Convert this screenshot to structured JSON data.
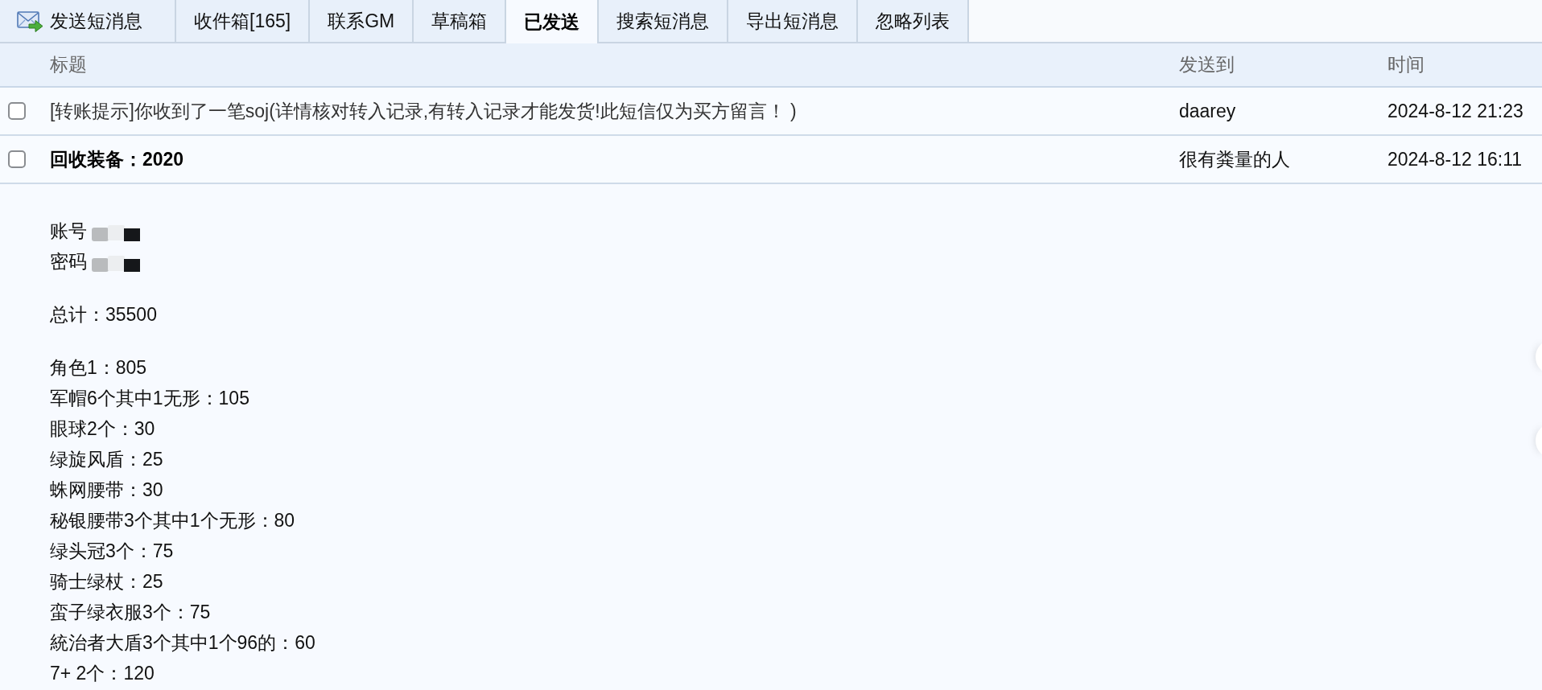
{
  "tabs": [
    {
      "kind": "compose",
      "label": "发送短消息",
      "selected": false
    },
    {
      "kind": "tab",
      "label": "收件箱[165]",
      "selected": false
    },
    {
      "kind": "tab",
      "label": "联系GM",
      "selected": false
    },
    {
      "kind": "tab",
      "label": "草稿箱",
      "selected": false
    },
    {
      "kind": "tab",
      "label": "已发送",
      "selected": true
    },
    {
      "kind": "tab",
      "label": "搜索短消息",
      "selected": false
    },
    {
      "kind": "tab",
      "label": "导出短消息",
      "selected": false
    },
    {
      "kind": "tab",
      "label": "忽略列表",
      "selected": false
    }
  ],
  "table": {
    "columns": [
      "标题",
      "发送到",
      "时间"
    ],
    "rows": [
      {
        "checked": false,
        "expanded": false,
        "title": "[转账提示]你收到了一笔soj(详情核对转入记录,有转入记录才能发货!此短信仅为买方留言！ )",
        "recipient": "daarey",
        "time": "2024-8-12 21:23"
      },
      {
        "checked": false,
        "expanded": true,
        "title": "回收装备：2020",
        "recipient": "很有粪量的人",
        "time": "2024-8-12 16:11"
      }
    ]
  },
  "message": {
    "paragraphs": [
      {
        "lines": [
          {
            "text": "账号",
            "redacted": true
          },
          {
            "text": "密码",
            "redacted": true
          }
        ]
      },
      {
        "lines": [
          {
            "text": "总计：35500",
            "redacted": false
          }
        ]
      },
      {
        "lines": [
          {
            "text": "角色1：805",
            "redacted": false
          },
          {
            "text": "军帽6个其中1无形：105",
            "redacted": false
          },
          {
            "text": "眼球2个：30",
            "redacted": false
          },
          {
            "text": "绿旋风盾：25",
            "redacted": false
          },
          {
            "text": "蛛网腰带：30",
            "redacted": false
          },
          {
            "text": "秘银腰带3个其中1个无形：80",
            "redacted": false
          },
          {
            "text": "绿头冠3个：75",
            "redacted": false
          },
          {
            "text": "骑士绿杖：25",
            "redacted": false
          },
          {
            "text": "蛮子绿衣服3个：75",
            "redacted": false
          },
          {
            "text": "統治者大盾3个其中1个96的：60",
            "redacted": false
          },
          {
            "text": "7+ 2个：120",
            "redacted": false
          }
        ]
      }
    ]
  }
}
